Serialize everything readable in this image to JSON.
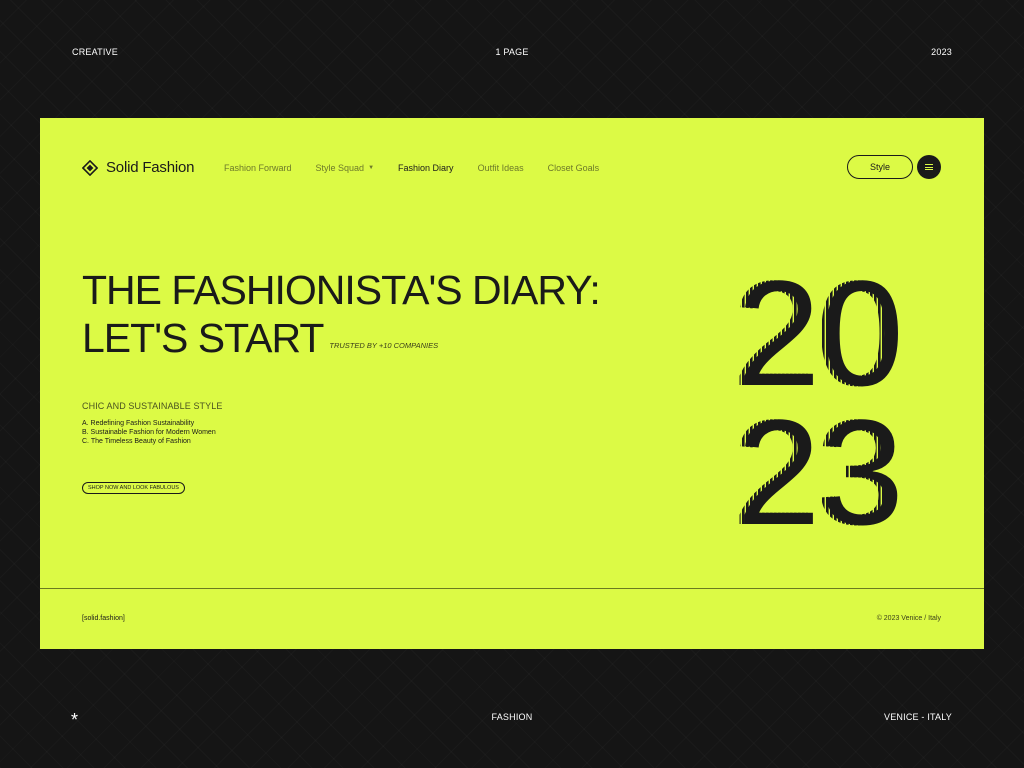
{
  "frame": {
    "top_left": "CREATIVE",
    "top_center": "1 PAGE",
    "top_right": "2023",
    "bottom_star": "*",
    "bottom_center": "FASHION",
    "bottom_right": "VENICE - ITALY"
  },
  "brand": {
    "name": "Solid Fashion",
    "icon": "diamond-logo-icon"
  },
  "nav": {
    "items": [
      {
        "label": "Fashion Forward"
      },
      {
        "label": "Style Squad",
        "has_dropdown": true
      },
      {
        "label": "Fashion Diary",
        "active": true
      },
      {
        "label": "Outfit Ideas"
      },
      {
        "label": "Closet Goals"
      }
    ]
  },
  "header": {
    "style_button": "Style",
    "menu_icon": "hamburger-menu-icon"
  },
  "hero": {
    "line1": "THE FASHIONISTA'S DIARY:",
    "line2": "LET'S START",
    "trusted": "TRUSTED BY +10 COMPANIES",
    "subtitle": "CHIC AND SUSTAINABLE STYLE",
    "list": [
      "A. Redefining Fashion Sustainability",
      "B. Sustainable Fashion for Modern Women",
      "C. The Timeless Beauty of Fashion"
    ],
    "cta": "SHOP NOW AND LOOK FABULOUS",
    "year_top": "20",
    "year_bottom": "23"
  },
  "footer": {
    "left": "[solid.fashion]",
    "right": "© 2023 Venice / Italy"
  },
  "colors": {
    "accent": "#dcfa45",
    "dark": "#151515",
    "ink": "#1a1a1a"
  }
}
